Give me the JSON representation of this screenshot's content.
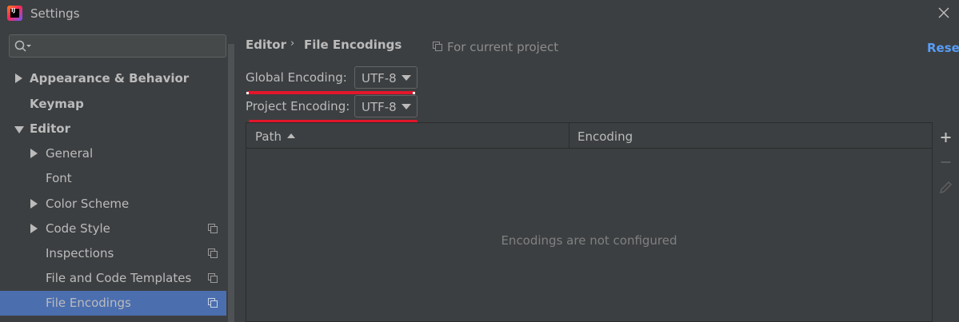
{
  "window": {
    "title": "Settings"
  },
  "search": {
    "placeholder": ""
  },
  "sidebar": {
    "items": [
      {
        "label": "Appearance & Behavior",
        "bold": true,
        "expander": "collapsed"
      },
      {
        "label": "Keymap",
        "bold": true
      },
      {
        "label": "Editor",
        "bold": true,
        "expander": "expanded"
      },
      {
        "label": "General",
        "expander": "collapsed"
      },
      {
        "label": "Font"
      },
      {
        "label": "Color Scheme",
        "expander": "collapsed"
      },
      {
        "label": "Code Style",
        "expander": "collapsed",
        "project_icon": "copy-icon"
      },
      {
        "label": "Inspections",
        "project_icon": "copy-icon"
      },
      {
        "label": "File and Code Templates",
        "project_icon": "copy-icon"
      },
      {
        "label": "File Encodings",
        "selected": true,
        "project_icon": "copy-icon"
      }
    ]
  },
  "breadcrumb": {
    "parent": "Editor",
    "separator": "›",
    "current": "File Encodings"
  },
  "scope_note": "For current project",
  "reset_label": "Reset",
  "global_encoding": {
    "label": "Global Encoding:",
    "value": "UTF-8"
  },
  "project_encoding": {
    "label": "Project Encoding:",
    "value": "UTF-8"
  },
  "table": {
    "columns": [
      "Path",
      "Encoding"
    ],
    "sort_column": "Path",
    "sort_direction": "ascending",
    "empty_text": "Encodings are not configured"
  },
  "toolbar": {
    "add": "add-icon",
    "remove": "remove-icon",
    "edit": "edit-icon"
  },
  "colors": {
    "background": "#3c3f41",
    "selection": "#4b6eaf",
    "link": "#589df6",
    "annotation": "#e3162a"
  }
}
